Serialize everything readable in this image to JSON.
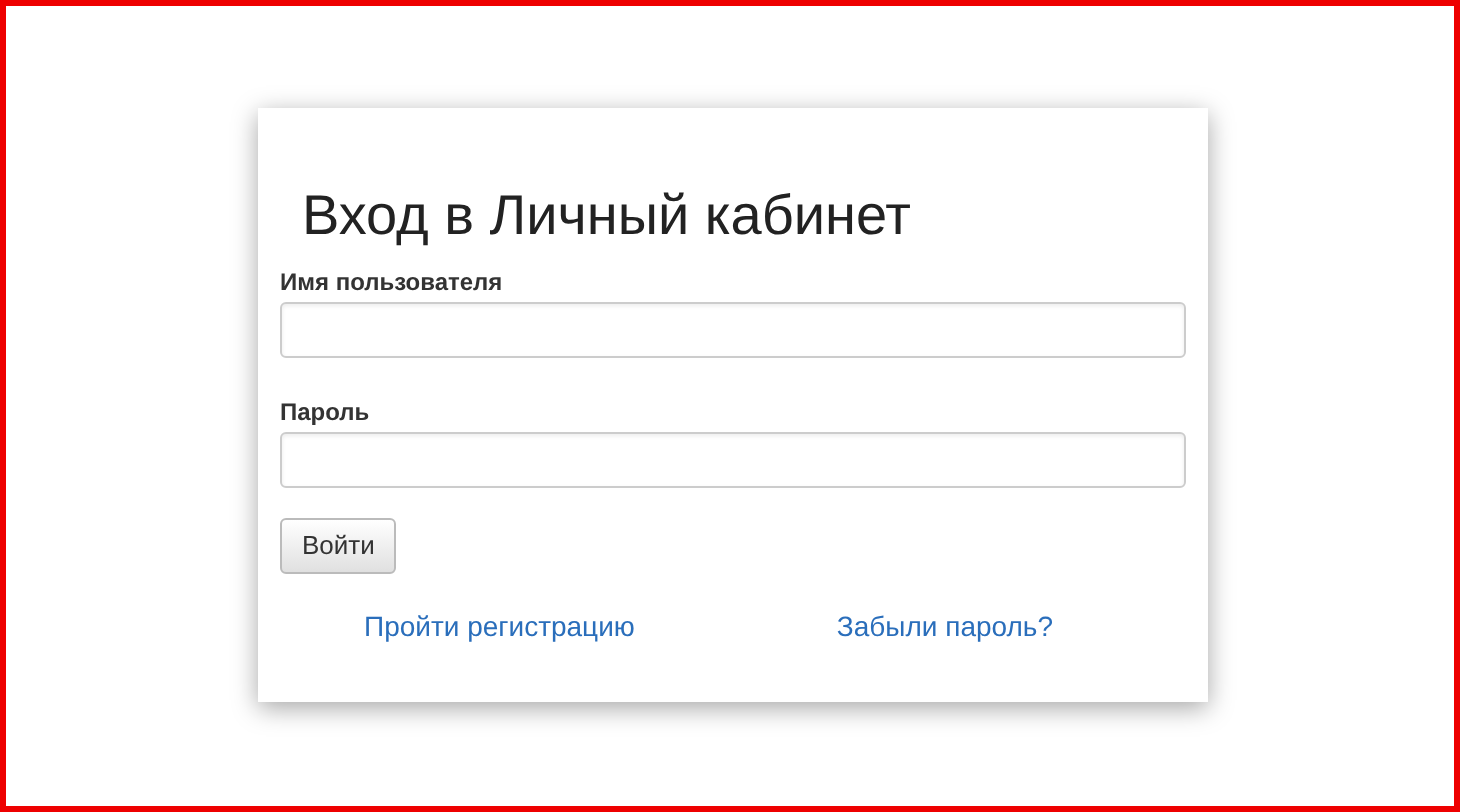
{
  "title": "Вход в Личный кабинет",
  "fields": [
    {
      "label": "Имя пользователя"
    },
    {
      "label": "Пароль"
    }
  ],
  "submit_button": "Войти",
  "links": [
    "Пройти регистрацию",
    "Забыли пароль?"
  ]
}
